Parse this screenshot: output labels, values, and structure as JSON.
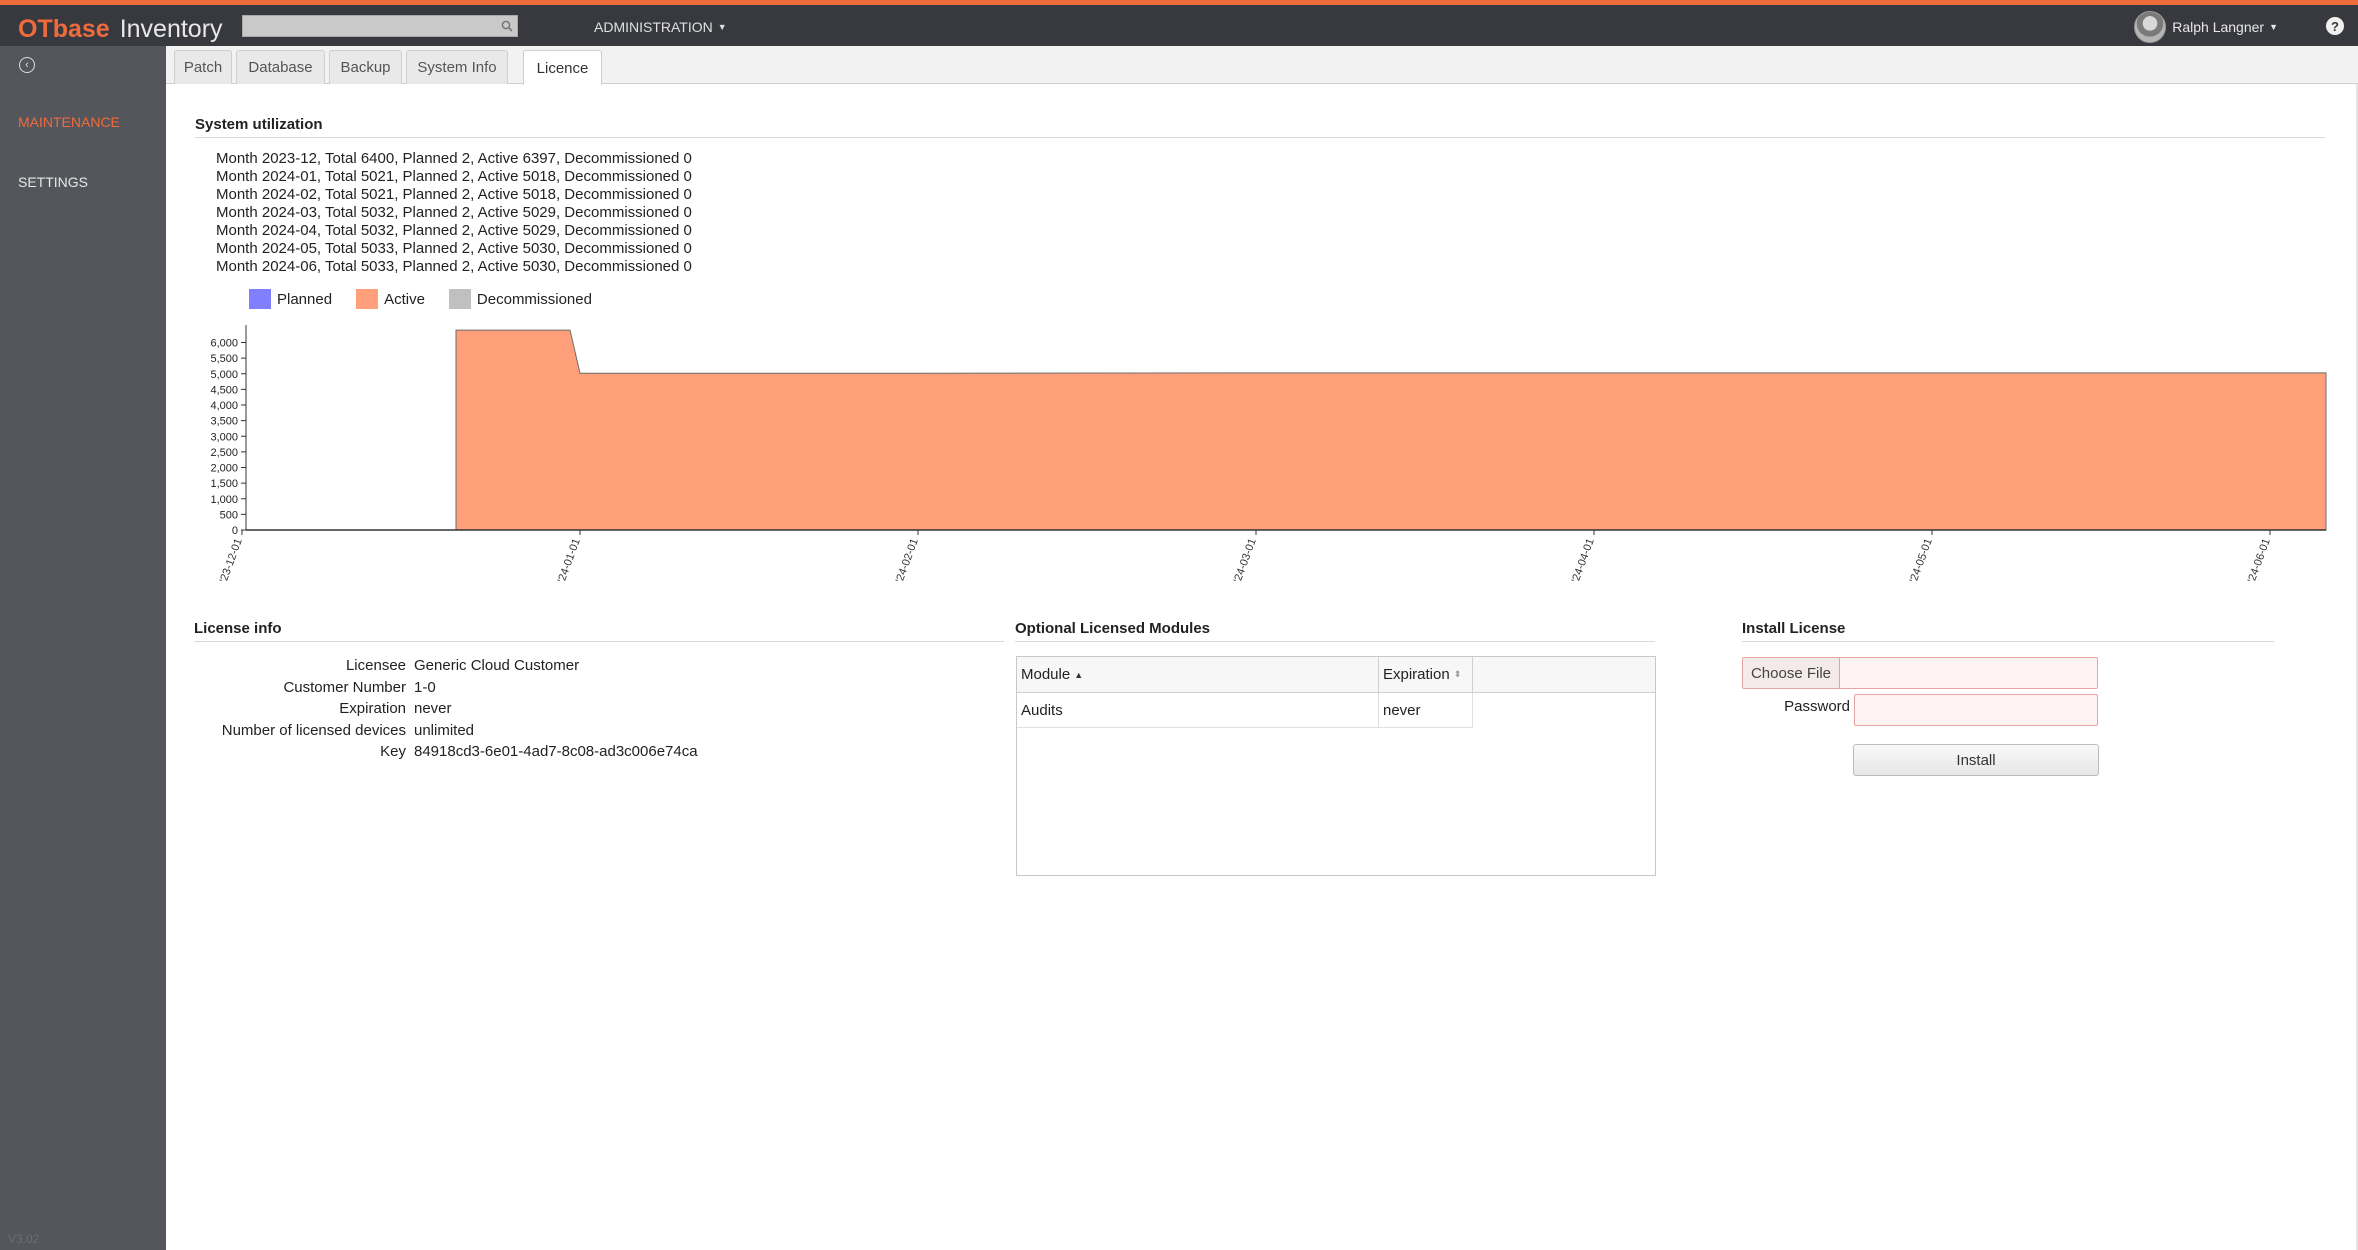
{
  "header": {
    "logo_ot": "OT",
    "logo_base": "base",
    "app_name": "Inventory",
    "search_placeholder": "",
    "admin_menu": "ADMINISTRATION",
    "user_name": "Ralph Langner",
    "help": "?"
  },
  "sidebar": {
    "items": [
      {
        "label": "MAINTENANCE",
        "active": true
      },
      {
        "label": "SETTINGS",
        "active": false
      }
    ],
    "version": "V3.02"
  },
  "tabs": [
    {
      "label": "Patch"
    },
    {
      "label": "Database"
    },
    {
      "label": "Backup"
    },
    {
      "label": "System Info"
    },
    {
      "label": "Licence",
      "active": true
    }
  ],
  "system_utilization": {
    "title": "System utilization",
    "lines": [
      "Month 2023-12, Total 6400, Planned 2, Active 6397, Decommissioned 0",
      "Month 2024-01, Total 5021, Planned 2, Active 5018, Decommissioned 0",
      "Month 2024-02, Total 5021, Planned 2, Active 5018, Decommissioned 0",
      "Month 2024-03, Total 5032, Planned 2, Active 5029, Decommissioned 0",
      "Month 2024-04, Total 5032, Planned 2, Active 5029, Decommissioned 0",
      "Month 2024-05, Total 5033, Planned 2, Active 5030, Decommissioned 0",
      "Month 2024-06, Total 5033, Planned 2, Active 5030, Decommissioned 0"
    ],
    "legend": [
      {
        "label": "Planned",
        "color": "#8080ff"
      },
      {
        "label": "Active",
        "color": "#ffa07a"
      },
      {
        "label": "Decommissioned",
        "color": "#c0c0c0"
      }
    ]
  },
  "chart_data": {
    "type": "area",
    "x": [
      "2023-12-01",
      "2024-01-01",
      "2024-02-01",
      "2024-03-01",
      "2024-04-01",
      "2024-05-01",
      "2024-06-01"
    ],
    "x_tick_labels": [
      "'23-12-01",
      "'24-01-01",
      "'24-02-01",
      "'24-03-01",
      "'24-04-01",
      "'24-05-01",
      "'24-06-01"
    ],
    "series": [
      {
        "name": "Active",
        "values": [
          6397,
          5018,
          5018,
          5029,
          5029,
          5030,
          5030
        ],
        "color": "#ffa07a"
      },
      {
        "name": "Planned",
        "values": [
          2,
          2,
          2,
          2,
          2,
          2,
          2
        ],
        "color": "#8080ff"
      },
      {
        "name": "Decommissioned",
        "values": [
          0,
          0,
          0,
          0,
          0,
          0,
          0
        ],
        "color": "#c0c0c0"
      }
    ],
    "y_ticks": [
      "0",
      "500",
      "1,000",
      "1,500",
      "2,000",
      "2,500",
      "3,000",
      "3,500",
      "4,000",
      "4,500",
      "5,000",
      "5,500",
      "6,000"
    ],
    "ylim": [
      0,
      6400
    ],
    "grid": false
  },
  "license_info": {
    "title": "License info",
    "rows": [
      {
        "key": "Licensee",
        "value": "Generic Cloud Customer"
      },
      {
        "key": "Customer Number",
        "value": "1-0"
      },
      {
        "key": "Expiration",
        "value": "never"
      },
      {
        "key": "Number of licensed devices",
        "value": "unlimited"
      },
      {
        "key": "Key",
        "value": "84918cd3-6e01-4ad7-8c08-ad3c006e74ca"
      }
    ]
  },
  "modules": {
    "title": "Optional Licensed Modules",
    "columns": [
      "Module",
      "Expiration"
    ],
    "rows": [
      {
        "module": "Audits",
        "expiration": "never"
      }
    ]
  },
  "install": {
    "title": "Install License",
    "choose_file": "Choose File",
    "password_label": "Password",
    "password_value": "",
    "install_button": "Install"
  }
}
